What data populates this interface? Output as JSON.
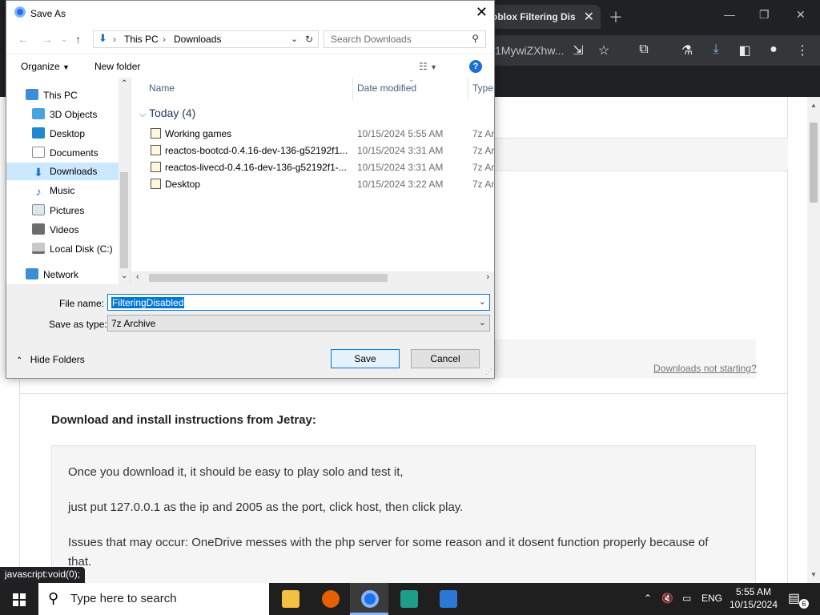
{
  "browser": {
    "tab_title": "oblox Filtering Dis",
    "url_fragment": "1MywiZXhw...",
    "downloads_not_starting": "Downloads not starting?",
    "section_title": "Download and install instructions from Jetray:",
    "instructions": [
      "Once you download it, it should be easy to play solo and test it,",
      "just put 127.0.0.1 as the ip and 2005 as the port, click host, then click play.",
      "Issues that may occur: OneDrive messes with the php server for some reason and it dosent function properly because of",
      "that."
    ],
    "status_text": "javascript:void(0);"
  },
  "dialog": {
    "title": "Save As",
    "breadcrumb": [
      "This PC",
      "Downloads"
    ],
    "search_placeholder": "Search Downloads",
    "organize_label": "Organize",
    "new_folder_label": "New folder",
    "help_label": "?",
    "nav_items": [
      {
        "label": "This PC",
        "icon": "pc-icon",
        "color": "#3c8fd6"
      },
      {
        "label": "3D Objects",
        "icon": "cube-icon",
        "color": "#4aa3df"
      },
      {
        "label": "Desktop",
        "icon": "desktop-icon",
        "color": "#1e88d0"
      },
      {
        "label": "Documents",
        "icon": "documents-icon",
        "color": "#8c8c8c"
      },
      {
        "label": "Downloads",
        "icon": "downloads-icon",
        "color": "#1e6fc8"
      },
      {
        "label": "Music",
        "icon": "music-icon",
        "color": "#1e6fc8"
      },
      {
        "label": "Pictures",
        "icon": "pictures-icon",
        "color": "#8c8c8c"
      },
      {
        "label": "Videos",
        "icon": "videos-icon",
        "color": "#6d6d6d"
      },
      {
        "label": "Local Disk (C:)",
        "icon": "disk-icon",
        "color": "#6d6d6d"
      },
      {
        "label": "Network",
        "icon": "network-icon",
        "color": "#3c8fd6"
      }
    ],
    "columns": [
      "Name",
      "Date modified",
      "Type"
    ],
    "group_label": "Today (4)",
    "files": [
      {
        "name": "Working games",
        "date": "10/15/2024 5:55 AM",
        "type": "7z Ar"
      },
      {
        "name": "reactos-bootcd-0.4.16-dev-136-g52192f1...",
        "date": "10/15/2024 3:31 AM",
        "type": "7z Ar"
      },
      {
        "name": "reactos-livecd-0.4.16-dev-136-g52192f1-...",
        "date": "10/15/2024 3:31 AM",
        "type": "7z Ar"
      },
      {
        "name": "Desktop",
        "date": "10/15/2024 3:22 AM",
        "type": "7z Ar"
      }
    ],
    "file_name_label": "File name:",
    "file_name_value": "FilteringDisabled",
    "save_type_label": "Save as type:",
    "save_type_value": "7z Archive",
    "hide_folders_label": "Hide Folders",
    "save_label": "Save",
    "cancel_label": "Cancel"
  },
  "taskbar": {
    "search_placeholder": "Type here to search",
    "language": "ENG",
    "time": "5:55 AM",
    "date": "10/15/2024",
    "notification_count": "6"
  }
}
